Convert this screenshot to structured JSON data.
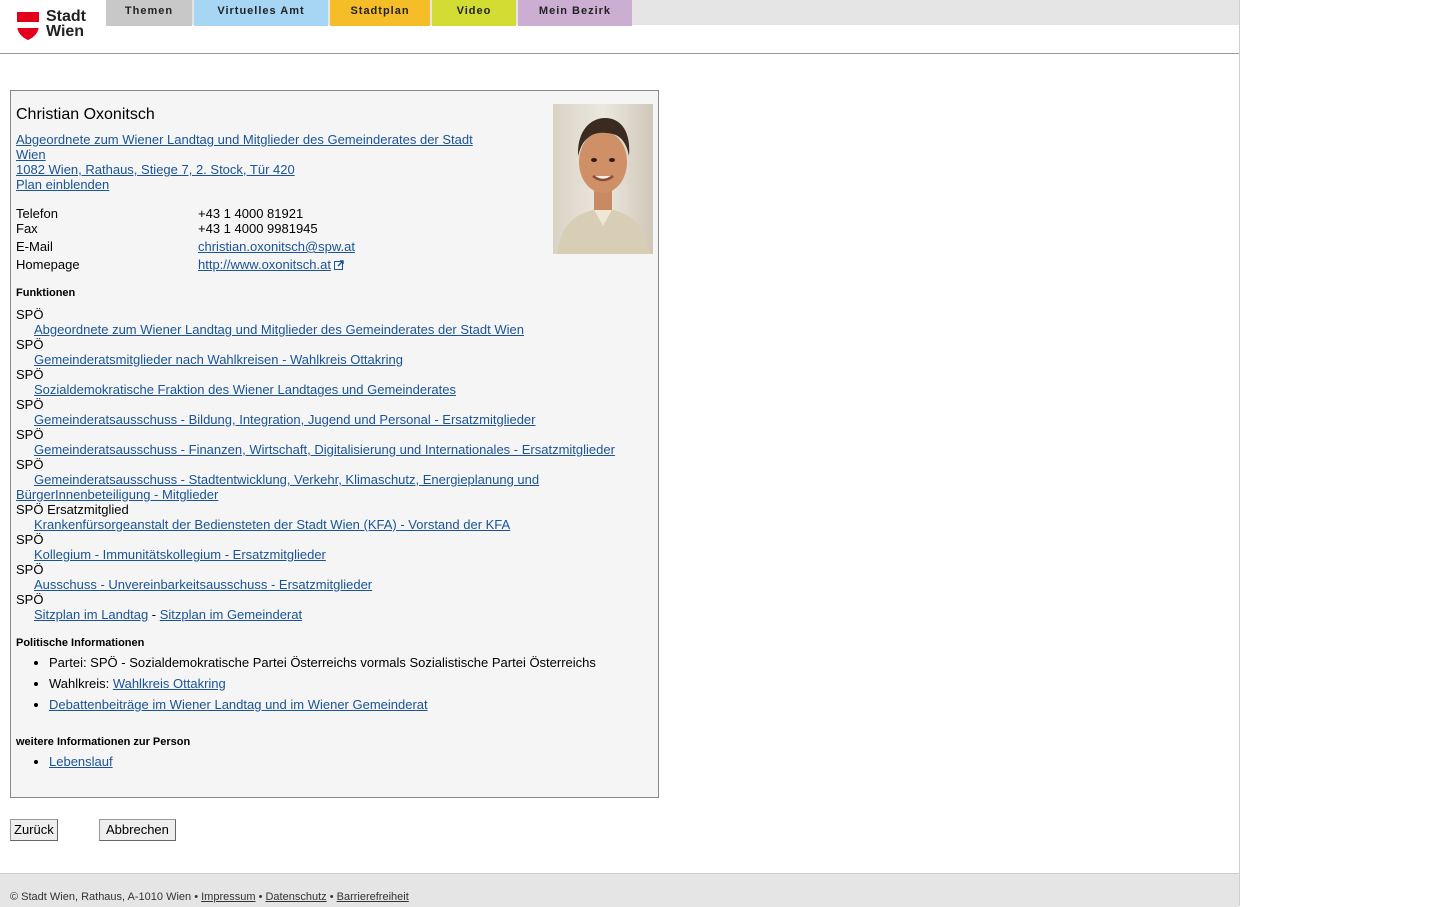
{
  "logo": {
    "line1": "Stadt",
    "line2": "Wien"
  },
  "nav": [
    {
      "label": "Themen",
      "color": "#c8c8c8",
      "width": 86
    },
    {
      "label": "Virtuelles Amt",
      "color": "#a6d6f4",
      "width": 134
    },
    {
      "label": "Stadtplan",
      "color": "#f5be28",
      "width": 100
    },
    {
      "label": "Video",
      "color": "#d2dc32",
      "width": 84
    },
    {
      "label": "Mein Bezirk",
      "color": "#ccaed2",
      "width": 114
    }
  ],
  "person": {
    "name": "Christian Oxonitsch",
    "org_line1": "Abgeordnete zum Wiener Landtag und Mitglieder des Gemeinderates der Stadt",
    "org_line2": "Wien",
    "address": "1082 Wien, Rathaus, Stiege 7, 2. Stock, Tür 420",
    "plan_link": "Plan einblenden"
  },
  "contacts": {
    "telefon_label": "Telefon",
    "telefon": "+43 1 4000 81921",
    "fax_label": "Fax",
    "fax": "+43 1 4000 9981945",
    "email_label": "E-Mail",
    "email": "christian.oxonitsch@spw.at",
    "homepage_label": "Homepage",
    "homepage": "http://www.oxonitsch.at"
  },
  "functions": {
    "heading": "Funktionen",
    "items": [
      {
        "party": "SPÖ",
        "link": "Abgeordnete zum Wiener Landtag und Mitglieder des Gemeinderates der Stadt Wien"
      },
      {
        "party": "SPÖ",
        "link": "Gemeinderatsmitglieder nach Wahlkreisen - Wahlkreis Ottakring"
      },
      {
        "party": "SPÖ",
        "link": "Sozialdemokratische Fraktion des Wiener Landtages und Gemeinderates"
      },
      {
        "party": "SPÖ",
        "link": "Gemeinderatsausschuss - Bildung, Integration, Jugend und Personal - Ersatzmitglieder"
      },
      {
        "party": "SPÖ",
        "link": "Gemeinderatsausschuss - Finanzen, Wirtschaft, Digitalisierung und Internationales - Ersatzmitglieder"
      },
      {
        "party": "SPÖ",
        "link": "Gemeinderatsausschuss - Stadtentwicklung, Verkehr, Klimaschutz, Energieplanung und BürgerInnenbeteiligung - Mitglieder",
        "wrap": true
      },
      {
        "party": "SPÖ Ersatzmitglied",
        "link": "Krankenfürsorgeanstalt der Bediensteten der Stadt Wien (KFA) - Vorstand der KFA"
      },
      {
        "party": "SPÖ",
        "link": "Kollegium - Immunitätskollegium - Ersatzmitglieder"
      },
      {
        "party": "SPÖ",
        "link": "Ausschuss - Unvereinbarkeitsausschuss - Ersatzmitglieder"
      }
    ],
    "last_party": "SPÖ",
    "sitzplan_landtag": "Sitzplan im Landtag",
    "sitzplan_sep": " - ",
    "sitzplan_gemeinderat": "Sitzplan im Gemeinderat"
  },
  "political": {
    "heading": "Politische Informationen",
    "partei": "Partei: SPÖ - Sozialdemokratische Partei Österreichs vormals Sozialistische Partei Österreichs",
    "wahlkreis_label": "Wahlkreis: ",
    "wahlkreis_link": "Wahlkreis Ottakring",
    "debatten_link": "Debattenbeiträge im Wiener Landtag und im Wiener Gemeinderat"
  },
  "weitere": {
    "heading": "weitere Informationen zur Person",
    "lebenslauf": "Lebenslauf"
  },
  "buttons": {
    "back": "Zurück",
    "cancel": "Abbrechen"
  },
  "footer": {
    "copyright": "© Stadt Wien, Rathaus, A-1010 Wien",
    "sep": " • ",
    "impressum": "Impressum",
    "datenschutz": "Datenschutz",
    "barrierefreiheit": "Barrierefreiheit"
  }
}
